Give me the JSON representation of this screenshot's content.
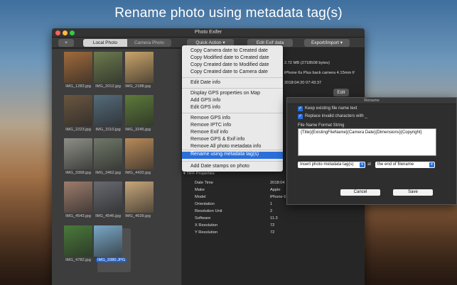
{
  "banner": {
    "title": "Rename photo using metadata tag(s)"
  },
  "window": {
    "title": "Photo Exifer"
  },
  "toolbar": {
    "add_label": "+",
    "tab_local": "Local Photo",
    "tab_camera": "Camera Photo",
    "quick_action": "Quick Action ▾",
    "edit_exif": "Edit Exif data",
    "export_import": "Export/Import ▾"
  },
  "photos": [
    {
      "name": "IMG_1283.jpg",
      "color": "#a06a3c"
    },
    {
      "name": "IMG_2012.jpg",
      "color": "#6c7a4e"
    },
    {
      "name": "IMG_2188.jpg",
      "color": "#caa46a"
    },
    {
      "name": "IMG_2223.jpg",
      "color": "#6a5640"
    },
    {
      "name": "IMG_3110.jpg",
      "color": "#556b7a"
    },
    {
      "name": "IMG_3245.jpg",
      "color": "#5d7a3a"
    },
    {
      "name": "IMG_3368.jpg",
      "color": "#8d8f86"
    },
    {
      "name": "IMG_3462.jpg",
      "color": "#707868"
    },
    {
      "name": "IMG_4432.jpg",
      "color": "#b78a5a"
    },
    {
      "name": "IMG_4543.jpg",
      "color": "#9c7c6c"
    },
    {
      "name": "IMG_4546.jpg",
      "color": "#686a70"
    },
    {
      "name": "IMG_4639.jpg",
      "color": "#c7a67a"
    },
    {
      "name": "IMG_4782.jpg",
      "color": "#4a7a3a"
    },
    {
      "name": "IMG_3380.JPG",
      "color": "#7aa7c7"
    }
  ],
  "info": {
    "size": "2.72 MB (2718508 bytes)",
    "camera": "iPhone 6s Plus back camera 4.15mm f/",
    "date": "2018:04:20 07:43:37",
    "edit_label": "Edit",
    "tiff_header": "▾ TIFF Properties"
  },
  "tiff": [
    {
      "key": "Date Time",
      "value": "2018:04"
    },
    {
      "key": "Make",
      "value": "Apple"
    },
    {
      "key": "Model",
      "value": "iPhone 6"
    },
    {
      "key": "Orientation",
      "value": "1"
    },
    {
      "key": "Resolution Unit",
      "value": "2"
    },
    {
      "key": "Software",
      "value": "11.3"
    },
    {
      "key": "X Resolution",
      "value": "72"
    },
    {
      "key": "Y Resolution",
      "value": "72"
    }
  ],
  "menu": {
    "items": [
      "Copy Camera date to Created date",
      "Copy Modified date to Created date",
      "Copy Created date to Modified date",
      "Copy Created date to Camera date",
      "Edit Date info",
      "Display GPS properties on Map",
      "Add GPS info",
      "Edit GPS  info",
      "Remove GPS info",
      "Remove IPTC info",
      "Remove Exif info",
      "Remove GPS & Exif info",
      "Remove All photo metadata info",
      "Rename using metadata tag(s)",
      "Add Date stamps on photo"
    ]
  },
  "dialog": {
    "title": "Rename",
    "keep_label": "Keep existing file name text",
    "replace_label": "Replace invalid characters with _",
    "format_label": "File Name Format String",
    "format_value": "{Title}{ExistingFileName}{Camera Date}{Dimensions}{Copyright}",
    "insert_select": "Insert photo metadata tag(s)",
    "at_label": "at",
    "position_select": "the end of filename",
    "cancel": "Cancel",
    "save": "Save"
  }
}
